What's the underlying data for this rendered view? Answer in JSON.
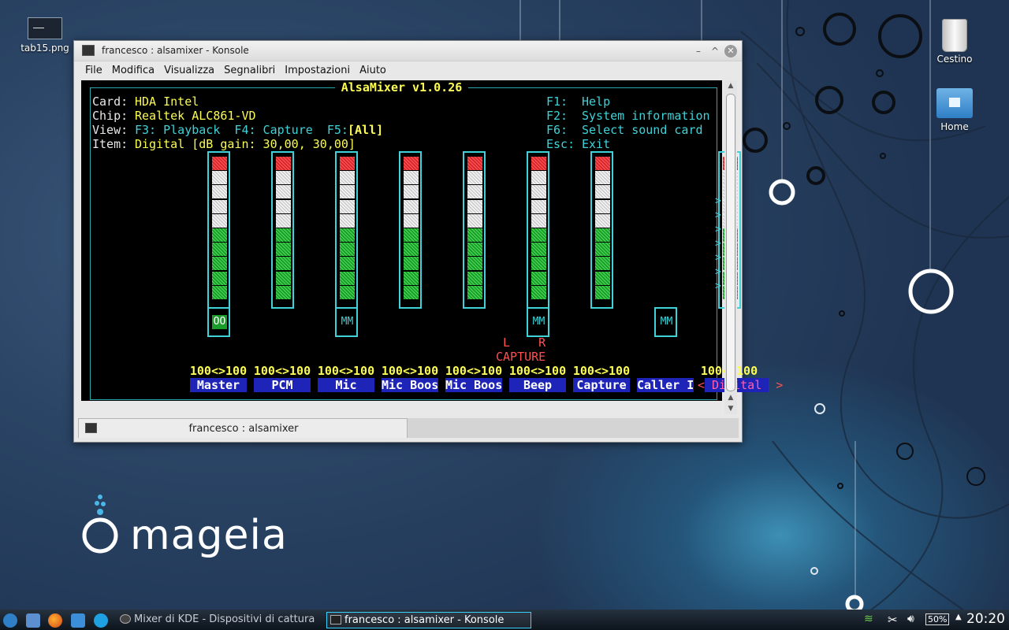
{
  "desktop": {
    "icons": [
      {
        "label": "tab15.png"
      },
      {
        "label": "Cestino"
      },
      {
        "label": "Home"
      }
    ],
    "logo": "mageia"
  },
  "window": {
    "title": "francesco : alsamixer - Konsole",
    "menu": [
      "File",
      "Modifica",
      "Visualizza",
      "Segnalibri",
      "Impostazioni",
      "Aiuto"
    ],
    "tab_label": "francesco : alsamixer"
  },
  "alsamixer": {
    "header": "AlsaMixer v1.0.26",
    "card_key": "Card:",
    "card": "HDA Intel",
    "chip_key": "Chip:",
    "chip": "Realtek ALC861-VD",
    "view_key": "View:",
    "view_opts": "F3: Playback  F4: Capture  F5:",
    "view_sel": "[All]",
    "item_key": "Item:",
    "item": "Digital [dB gain: 30,00, 30,00]",
    "help": [
      {
        "key": "F1:",
        "text": "Help"
      },
      {
        "key": "F2:",
        "text": "System information"
      },
      {
        "key": "F6:",
        "text": "Select sound card"
      },
      {
        "key": "Esc:",
        "text": "Exit"
      }
    ],
    "capture_lr": "L    R",
    "capture_label": "CAPTURE",
    "right_arrows": ">\n>\n>\n>\n>\n>\n>",
    "controls": [
      {
        "name": "Master",
        "volume": "100<>100",
        "mute": "OO",
        "level": 1.0
      },
      {
        "name": "PCM",
        "volume": "100<>100",
        "mute": "",
        "level": 1.0
      },
      {
        "name": "Mic",
        "volume": "100<>100",
        "mute": "MM",
        "level": 1.0
      },
      {
        "name": "Mic Boos",
        "volume": "100<>100",
        "mute": "",
        "level": 1.0
      },
      {
        "name": "Mic Boos",
        "volume": "100<>100",
        "mute": "",
        "level": 1.0
      },
      {
        "name": "Beep",
        "volume": "100<>100",
        "mute": "MM",
        "level": 1.0
      },
      {
        "name": "Capture",
        "volume": "100<>100",
        "mute": "",
        "level": 1.0
      },
      {
        "name": "Caller I",
        "volume": "",
        "mute": "MM",
        "level": null
      },
      {
        "name": "Digital",
        "volume": "100<>100",
        "mute": "",
        "level": 1.0,
        "selected": true
      }
    ]
  },
  "taskbar": {
    "tasks": [
      {
        "label": "Mixer di KDE - Dispositivi di cattura"
      },
      {
        "label": "francesco : alsamixer - Konsole"
      }
    ],
    "battery": "50%",
    "clock": "20:20"
  },
  "colors": {
    "terminal_bg": "#000000",
    "cyan": "#3fd2d8",
    "yellow": "#fcfc54",
    "label_blue": "#1f24b8",
    "active_task": "#3bd1ff"
  }
}
